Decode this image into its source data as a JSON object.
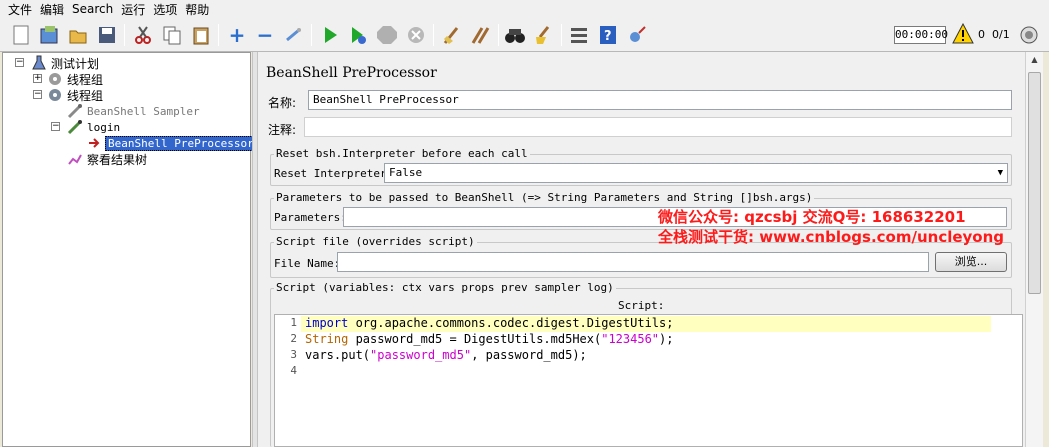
{
  "menu": [
    "文件",
    "编辑",
    "Search",
    "运行",
    "选项",
    "帮助"
  ],
  "toolbar": {
    "timer": "00:00:00",
    "warning_count": "0",
    "thread_count": "0/1",
    "icons": [
      "new-icon",
      "templates-icon",
      "open-icon",
      "save-icon",
      "cut-icon",
      "copy-icon",
      "paste-icon",
      "expand-icon",
      "collapse-icon",
      "toggle-icon",
      "start-icon",
      "start-no-pause-icon",
      "stop-icon",
      "shutdown-icon",
      "clear-icon",
      "clear-all-icon",
      "search-icon",
      "reset-search-icon",
      "function-helper-icon",
      "help-icon",
      "remote-icon"
    ]
  },
  "tree": {
    "test_plan": "测试计划",
    "thread_group_1": "线程组",
    "thread_group_2": "线程组",
    "beanshell_sampler": "BeanShell Sampler",
    "login": "login",
    "beanshell_preprocessor": "BeanShell PreProcessor",
    "view_results_tree": "察看结果树"
  },
  "panel": {
    "title": "BeanShell PreProcessor",
    "name_label": "名称:",
    "name_value": "BeanShell PreProcessor",
    "comment_label": "注释:",
    "comment_value": "",
    "reset_group_title": "Reset bsh.Interpreter before each call",
    "reset_label": "Reset Interpreter:",
    "reset_value": "False",
    "params_group_title": "Parameters to be passed to BeanShell (=> String Parameters and String []bsh.args)",
    "params_label": "Parameters:",
    "params_value": "",
    "file_group_title": "Script file (overrides script)",
    "file_label": "File Name:",
    "file_value": "",
    "browse_label": "浏览...",
    "script_group_title": "Script (variables: ctx vars props prev sampler log)",
    "script_caption": "Script:",
    "code_lines": [
      {
        "n": "1",
        "parts": [
          {
            "t": "import",
            "c": "kw"
          },
          {
            "t": " org.apache.commons.codec.digest.DigestUtils;",
            "c": ""
          }
        ]
      },
      {
        "n": "2",
        "parts": [
          {
            "t": "String",
            "c": "tp"
          },
          {
            "t": " password_md5 = DigestUtils.md5Hex(",
            "c": ""
          },
          {
            "t": "\"123456\"",
            "c": "str"
          },
          {
            "t": ");",
            "c": ""
          }
        ]
      },
      {
        "n": "3",
        "parts": [
          {
            "t": "vars.put(",
            "c": ""
          },
          {
            "t": "\"password_md5\"",
            "c": "str"
          },
          {
            "t": ", password_md5);",
            "c": ""
          }
        ]
      },
      {
        "n": "4",
        "parts": []
      }
    ]
  },
  "watermark": {
    "line1": "微信公众号: qzcsbj   交流Q号: 168632201",
    "line2": "全栈测试干货: www.cnblogs.com/uncleyong"
  }
}
